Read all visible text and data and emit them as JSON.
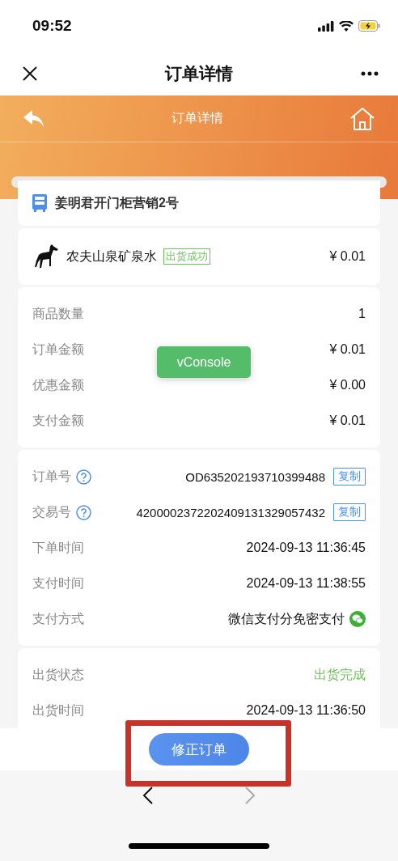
{
  "status_bar": {
    "time": "09:52"
  },
  "nav_bar": {
    "title": "订单详情"
  },
  "header": {
    "title": "订单详情"
  },
  "store": {
    "name": "姜明君开门柜营销2号"
  },
  "product": {
    "name": "农夫山泉矿泉水",
    "tag": "出货成功",
    "price": "¥ 0.01"
  },
  "summary": [
    {
      "label": "商品数量",
      "value": "1"
    },
    {
      "label": "订单金额",
      "value": "¥ 0.01"
    },
    {
      "label": "优惠金额",
      "value": "¥ 0.00"
    },
    {
      "label": "支付金额",
      "value": "¥ 0.01"
    }
  ],
  "order_info": [
    {
      "kind": "copy",
      "label": "订单号",
      "value": "OD635202193710399488",
      "copy": "复制"
    },
    {
      "kind": "copy",
      "label": "交易号",
      "value": "4200002372202409131329057432",
      "copy": "复制"
    },
    {
      "kind": "plain",
      "label": "下单时间",
      "value": "2024-09-13 11:36:45"
    },
    {
      "kind": "plain",
      "label": "支付时间",
      "value": "2024-09-13 11:38:55"
    },
    {
      "kind": "wechat",
      "label": "支付方式",
      "value": "微信支付分免密支付"
    }
  ],
  "shipment": [
    {
      "kind": "status",
      "label": "出货状态",
      "value": "出货完成"
    },
    {
      "kind": "plain",
      "label": "出货时间",
      "value": "2024-09-13 11:36:50"
    }
  ],
  "vconsole": {
    "label": "vConsole"
  },
  "action_button": {
    "label": "修正订单"
  },
  "browser_bar": {
    "back_disabled": false,
    "forward_disabled": true
  }
}
